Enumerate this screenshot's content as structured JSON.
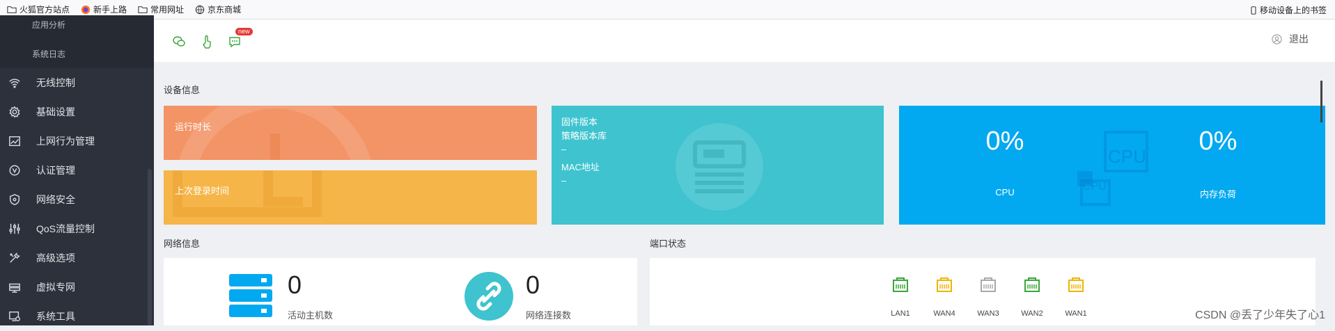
{
  "bookmarks": {
    "items": [
      {
        "label": "火狐官方站点",
        "icon": "folder-icon"
      },
      {
        "label": "新手上路",
        "icon": "firefox-icon"
      },
      {
        "label": "常用网址",
        "icon": "folder-icon"
      },
      {
        "label": "京东商城",
        "icon": "globe-icon"
      }
    ],
    "mobile": "移动设备上的书签"
  },
  "sidebar": {
    "subitems": [
      "应用分析",
      "系统日志"
    ],
    "items": [
      {
        "label": "无线控制",
        "icon": "wifi-icon"
      },
      {
        "label": "基础设置",
        "icon": "gear-icon"
      },
      {
        "label": "上网行为管理",
        "icon": "chart-icon"
      },
      {
        "label": "认证管理",
        "icon": "verify-icon"
      },
      {
        "label": "网络安全",
        "icon": "shield-icon"
      },
      {
        "label": "QoS流量控制",
        "icon": "sliders-icon"
      },
      {
        "label": "高级选项",
        "icon": "tools-icon"
      },
      {
        "label": "虚拟专网",
        "icon": "vpn-icon"
      },
      {
        "label": "系统工具",
        "icon": "system-tools-icon"
      }
    ]
  },
  "topbar": {
    "new_badge": "new",
    "logout": "退出"
  },
  "device_info": {
    "title": "设备信息",
    "uptime_label": "运行时长",
    "last_login_label": "上次登录时间",
    "firmware_label": "固件版本",
    "policy_label": "策略版本库",
    "policy_value": "–",
    "mac_label": "MAC地址",
    "mac_value": "–",
    "cpu_value": "0%",
    "cpu_label": "CPU",
    "mem_value": "0%",
    "mem_label": "内存负荷",
    "bg_cpu_text": "CPU",
    "bg_cpu_text_small": "CPU"
  },
  "network_info": {
    "title": "网络信息",
    "active_hosts_value": "0",
    "active_hosts_label": "活动主机数",
    "connections_value": "0",
    "connections_label": "网络连接数"
  },
  "port_status": {
    "title": "端口状态",
    "ports": [
      {
        "label": "LAN1",
        "color": "#3aa53a"
      },
      {
        "label": "WAN4",
        "color": "#f0b400"
      },
      {
        "label": "WAN3",
        "color": "#a8a8a8"
      },
      {
        "label": "WAN2",
        "color": "#3aa53a"
      },
      {
        "label": "WAN1",
        "color": "#f0b400"
      }
    ]
  },
  "colors": {
    "uptime": "#f39467",
    "last_login": "#f6b548",
    "firmware": "#3ec3cf",
    "cpu_panel": "#03a9f0"
  },
  "watermark": "CSDN @丢了少年失了心1"
}
